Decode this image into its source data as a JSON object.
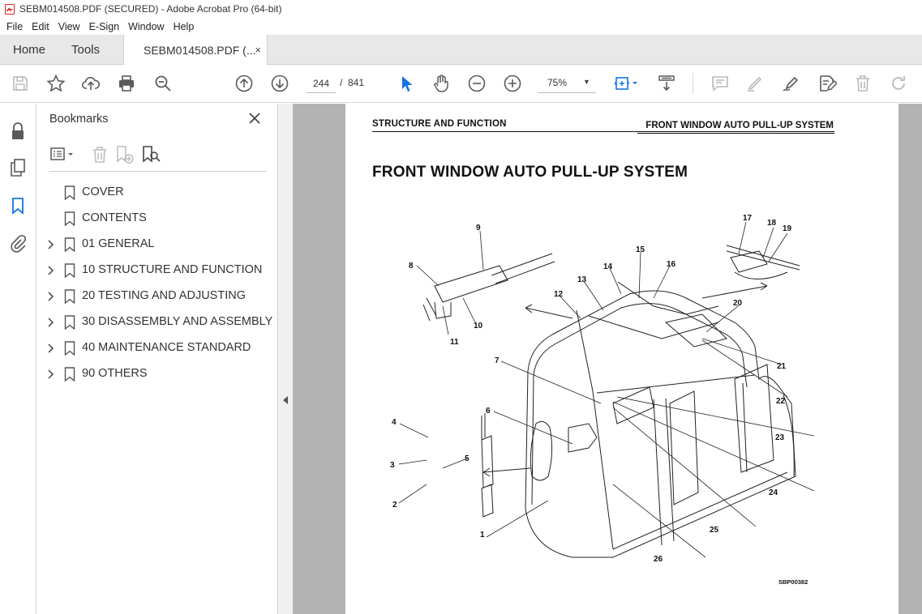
{
  "window": {
    "title": "SEBM014508.PDF (SECURED) - Adobe Acrobat Pro (64-bit)"
  },
  "menu": [
    "File",
    "Edit",
    "View",
    "E-Sign",
    "Window",
    "Help"
  ],
  "tabs": {
    "home": "Home",
    "tools": "Tools",
    "document": "SEBM014508.PDF (...",
    "close": "×"
  },
  "toolbar": {
    "current_page": "244",
    "separator": "/",
    "total_pages": "841",
    "zoom": "75%"
  },
  "bookmarks": {
    "title": "Bookmarks",
    "items": [
      {
        "label": "COVER",
        "expandable": false
      },
      {
        "label": "CONTENTS",
        "expandable": false
      },
      {
        "label": "01 GENERAL",
        "expandable": true
      },
      {
        "label": "10 STRUCTURE AND FUNCTION",
        "expandable": true
      },
      {
        "label": "20 TESTING AND ADJUSTING",
        "expandable": true
      },
      {
        "label": "30 DISASSEMBLY AND ASSEMBLY",
        "expandable": true
      },
      {
        "label": "40 MAINTENANCE STANDARD",
        "expandable": true
      },
      {
        "label": "90 OTHERS",
        "expandable": true
      }
    ]
  },
  "document_page": {
    "header_left": "STRUCTURE AND FUNCTION",
    "header_right": "FRONT WINDOW AUTO PULL-UP SYSTEM",
    "heading": "FRONT WINDOW AUTO PULL-UP SYSTEM",
    "figure_code": "SBP00382",
    "callouts": [
      "1",
      "2",
      "3",
      "4",
      "5",
      "6",
      "7",
      "8",
      "9",
      "10",
      "11",
      "12",
      "13",
      "14",
      "15",
      "16",
      "17",
      "18",
      "19",
      "20",
      "21",
      "22",
      "23",
      "24",
      "25",
      "26"
    ]
  },
  "colors": {
    "accent": "#1473e6",
    "icon": "#5a5a5a",
    "disabled_icon": "#b9b9b9",
    "pdf_red": "#d9261c"
  }
}
